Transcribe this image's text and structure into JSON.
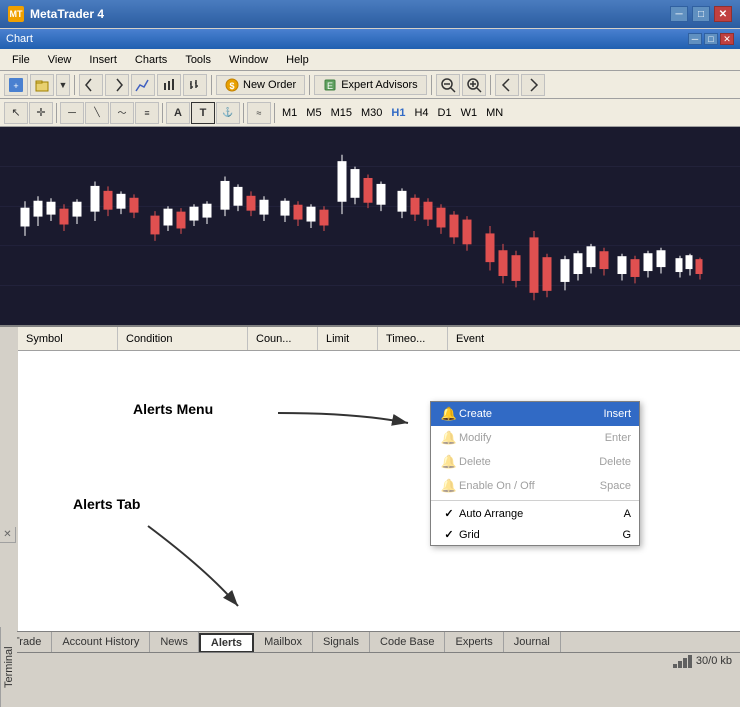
{
  "titleBar": {
    "icon": "MT",
    "title": "MetaTrader 4",
    "controls": [
      "minimize",
      "maximize",
      "close"
    ]
  },
  "menuBar": {
    "items": [
      "File",
      "View",
      "Insert",
      "Charts",
      "Tools",
      "Window",
      "Help"
    ]
  },
  "toolbar": {
    "buttons": [
      "arrow",
      "crosshair",
      "line",
      "arrow-diagonal",
      "zigzag",
      "bar",
      "text",
      "cursor"
    ],
    "newOrder": "New Order",
    "expertAdvisors": "Expert Advisors"
  },
  "timeframes": {
    "items": [
      "M1",
      "M5",
      "M15",
      "M30",
      "H1",
      "H4",
      "D1",
      "W1",
      "MN"
    ]
  },
  "terminalColumns": {
    "headers": [
      "Symbol",
      "Condition",
      "Coun...",
      "Limit",
      "Timeo...",
      "Event"
    ]
  },
  "contextMenu": {
    "items": [
      {
        "label": "Create",
        "shortcut": "Insert",
        "highlighted": true,
        "disabled": false,
        "icon": "bell",
        "check": ""
      },
      {
        "label": "Modify",
        "shortcut": "Enter",
        "highlighted": false,
        "disabled": true,
        "icon": "bell",
        "check": ""
      },
      {
        "label": "Delete",
        "shortcut": "Delete",
        "highlighted": false,
        "disabled": true,
        "icon": "bell",
        "check": ""
      },
      {
        "label": "Enable On / Off",
        "shortcut": "Space",
        "highlighted": false,
        "disabled": true,
        "icon": "bell",
        "check": ""
      },
      {
        "label": "Auto Arrange",
        "shortcut": "A",
        "highlighted": false,
        "disabled": false,
        "icon": "",
        "check": "✓"
      },
      {
        "label": "Grid",
        "shortcut": "G",
        "highlighted": false,
        "disabled": false,
        "icon": "",
        "check": "✓"
      }
    ]
  },
  "labels": {
    "alertsMenu": "Alerts Menu",
    "alertsTab": "Alerts Tab"
  },
  "bottomTabs": {
    "items": [
      "Trade",
      "Account History",
      "News",
      "Alerts",
      "Mailbox",
      "Signals",
      "Code Base",
      "Experts",
      "Journal"
    ],
    "active": "Alerts"
  },
  "statusBar": {
    "text": "30/0 kb"
  },
  "sideLabel": "Terminal"
}
